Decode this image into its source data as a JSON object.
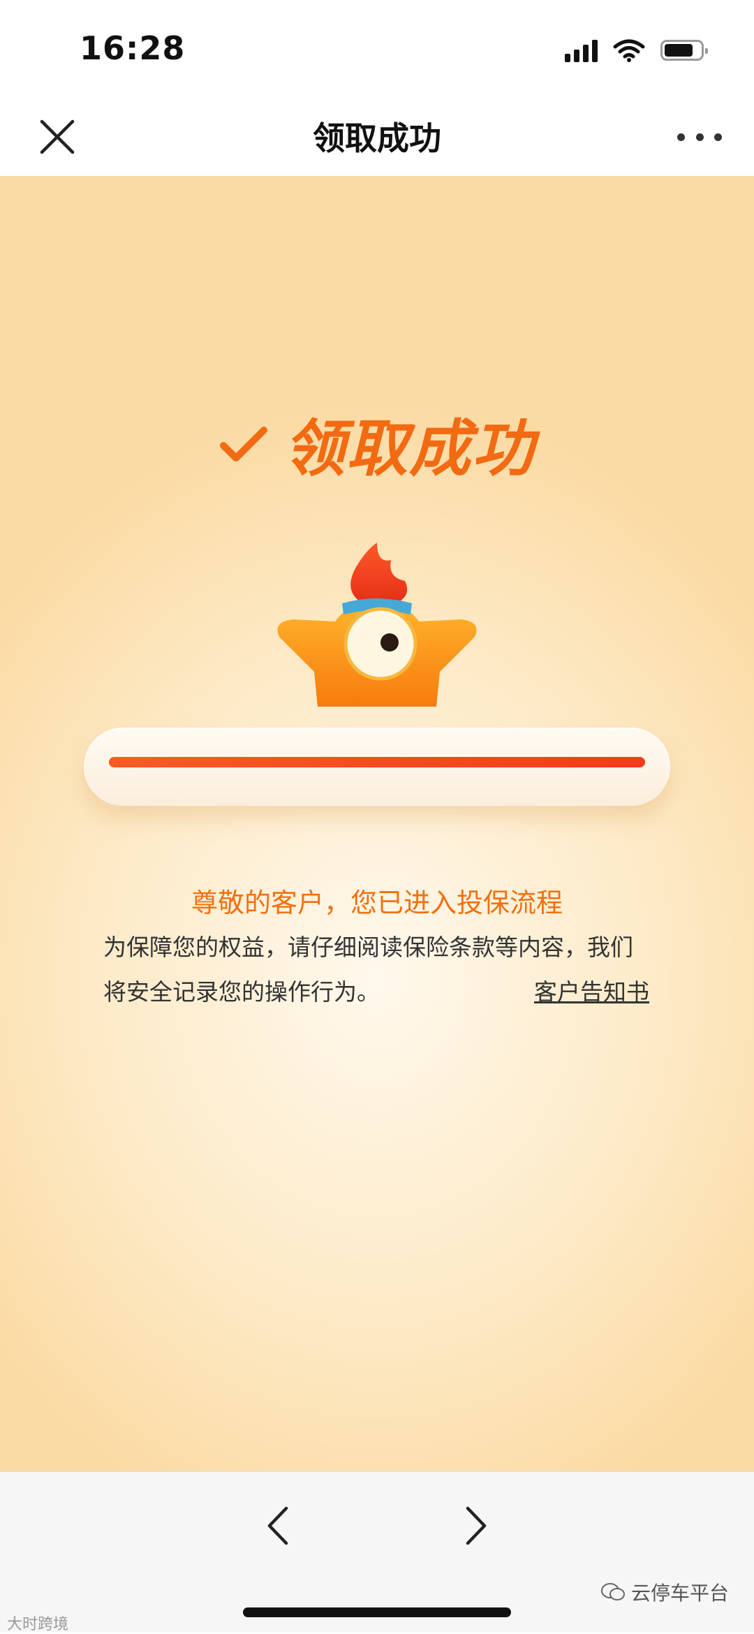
{
  "status_bar": {
    "time": "16:28"
  },
  "nav": {
    "title": "领取成功"
  },
  "main": {
    "heading": "领取成功",
    "progress": 1.0,
    "greeting": "尊敬的客户，您已进入投保流程",
    "notice": "为保障您的权益，请仔细阅读保险条款等内容，我们将安全记录您的操作行为。",
    "notice_link": "客户告知书"
  },
  "watermarks": {
    "left": "大时跨境",
    "right": "云停车平台"
  },
  "colors": {
    "accent": "#f26a12",
    "progress": "#f74a1c",
    "background": "#fdebc9"
  },
  "icons": [
    "close-icon",
    "more-icon",
    "check-icon",
    "back-icon",
    "forward-icon",
    "signal-icon",
    "wifi-icon",
    "battery-icon"
  ]
}
